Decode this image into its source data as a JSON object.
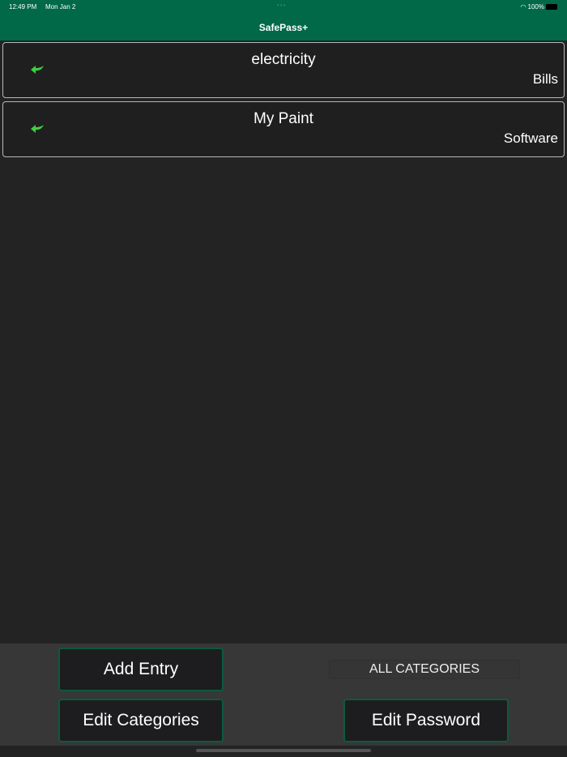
{
  "status_bar": {
    "time": "12:49 PM",
    "date": "Mon Jan 2",
    "battery": "100%"
  },
  "header": {
    "title": "SafePass+"
  },
  "entries": [
    {
      "name": "electricity",
      "category": "Bills"
    },
    {
      "name": "My Paint",
      "category": "Software"
    }
  ],
  "toolbar": {
    "add_entry": "Add Entry",
    "all_categories": "ALL CATEGORIES",
    "edit_categories": "Edit Categories",
    "edit_password": "Edit Password"
  },
  "colors": {
    "accent": "#016848",
    "arrow": "#3fcf3f"
  }
}
